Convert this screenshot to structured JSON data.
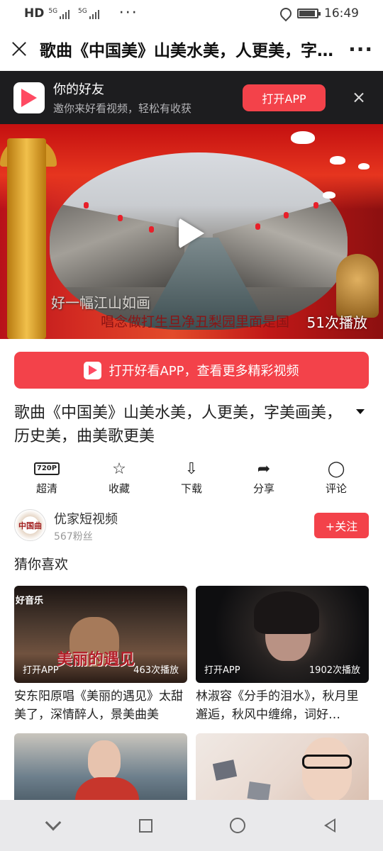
{
  "status_bar": {
    "network_label": "HD",
    "sim1": "5G",
    "sim2": "5G",
    "overflow": "···",
    "time": "16:49"
  },
  "header": {
    "title": "歌曲《中国美》山美水美，人更美，字美画美，历史美，曲美歌更美",
    "more": "···"
  },
  "app_banner": {
    "title": "你的好友",
    "subtitle": "邀你来好看视频，轻松有收获",
    "open_button": "打开APP"
  },
  "video": {
    "lyric_line1": "好一幅江山如画",
    "lyric_line2": "唱念做打生旦净丑梨园里面是国",
    "play_count": "51次播放"
  },
  "cta": {
    "label": "打开好看APP，查看更多精彩视频"
  },
  "video_info": {
    "title": "歌曲《中国美》山美水美，人更美，字美画美，历史美，曲美歌更美"
  },
  "actions": [
    {
      "icon": "hd-720p-icon",
      "badge": "720P",
      "label": "超清"
    },
    {
      "icon": "star-icon",
      "glyph": "☆",
      "label": "收藏"
    },
    {
      "icon": "download-icon",
      "glyph": "⇩",
      "label": "下载"
    },
    {
      "icon": "share-icon",
      "glyph": "➦",
      "label": "分享"
    },
    {
      "icon": "comment-icon",
      "glyph": "◯",
      "label": "评论"
    }
  ],
  "author": {
    "avatar_text": "中国曲",
    "name": "优家短视频",
    "fans": "567粉丝",
    "follow_label": "+关注"
  },
  "recommend": {
    "section_title": "猜你喜欢",
    "cards": [
      {
        "overlay_left": "打开APP",
        "overlay_right": "463次播放",
        "thumb_text": "美丽的遇见",
        "corner_text": "好音乐",
        "title": "安东阳原唱《美丽的遇见》太甜美了，深情醉人，景美曲美"
      },
      {
        "overlay_left": "打开APP",
        "overlay_right": "1902次播放",
        "title": "林淑容《分手的泪水》，秋月里邂逅，秋风中缠绵，词好…"
      },
      {
        "title": ""
      },
      {
        "title": ""
      }
    ]
  },
  "colors": {
    "brand_red": "#f3424a",
    "banner_bg": "#1d1d1f",
    "navbar_bg": "#e9e9eb"
  }
}
